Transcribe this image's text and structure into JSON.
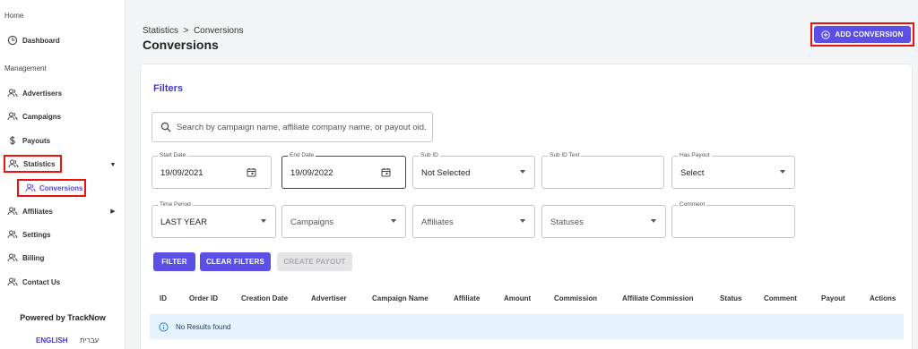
{
  "sidebar": {
    "home_title": "Home",
    "management_title": "Management",
    "items": {
      "dashboard": "Dashboard",
      "advertisers": "Advertisers",
      "campaigns": "Campaigns",
      "payouts": "Payouts",
      "statistics": "Statistics",
      "conversions": "Conversions",
      "affiliates": "Affiliates",
      "settings": "Settings",
      "billing": "Billing",
      "contact_us": "Contact Us"
    },
    "powered_by": "Powered by TrackNow",
    "languages": [
      "ENGLISH",
      "עברית"
    ]
  },
  "header": {
    "breadcrumb": "Statistics  >  Conversions",
    "title": "Conversions",
    "add_button": "ADD CONVERSION"
  },
  "filters": {
    "title": "Filters",
    "search_placeholder": "Search by campaign name, affiliate company name, or payout oid.",
    "start_date_label": "Start Date",
    "start_date": "19/09/2021",
    "end_date_label": "End Date",
    "end_date": "19/09/2022",
    "sub_id_label": "Sub ID",
    "sub_id_value": "Not Selected",
    "sub_id_text_label": "Sub ID Text",
    "has_payout_label": "Has Payout",
    "has_payout_value": "Select",
    "time_period_label": "Time Period",
    "time_period_value": "LAST YEAR",
    "campaigns_placeholder": "Campaigns",
    "affiliates_placeholder": "Affiliates",
    "statuses_placeholder": "Statuses",
    "comment_label": "Comment",
    "filter_button": "FILTER",
    "clear_button": "CLEAR FILTERS",
    "create_payout_button": "CREATE PAYOUT"
  },
  "table": {
    "columns": [
      "ID",
      "Order ID",
      "Creation Date",
      "Advertiser",
      "Campaign Name",
      "Affiliate",
      "Amount",
      "Commission",
      "Affiliate Commission",
      "Status",
      "Comment",
      "Payout",
      "Actions"
    ],
    "empty_message": "No Results found"
  },
  "colors": {
    "accent": "#5b4fe8",
    "highlight_border": "#ee1111",
    "info_bg": "#e4f2fd"
  }
}
